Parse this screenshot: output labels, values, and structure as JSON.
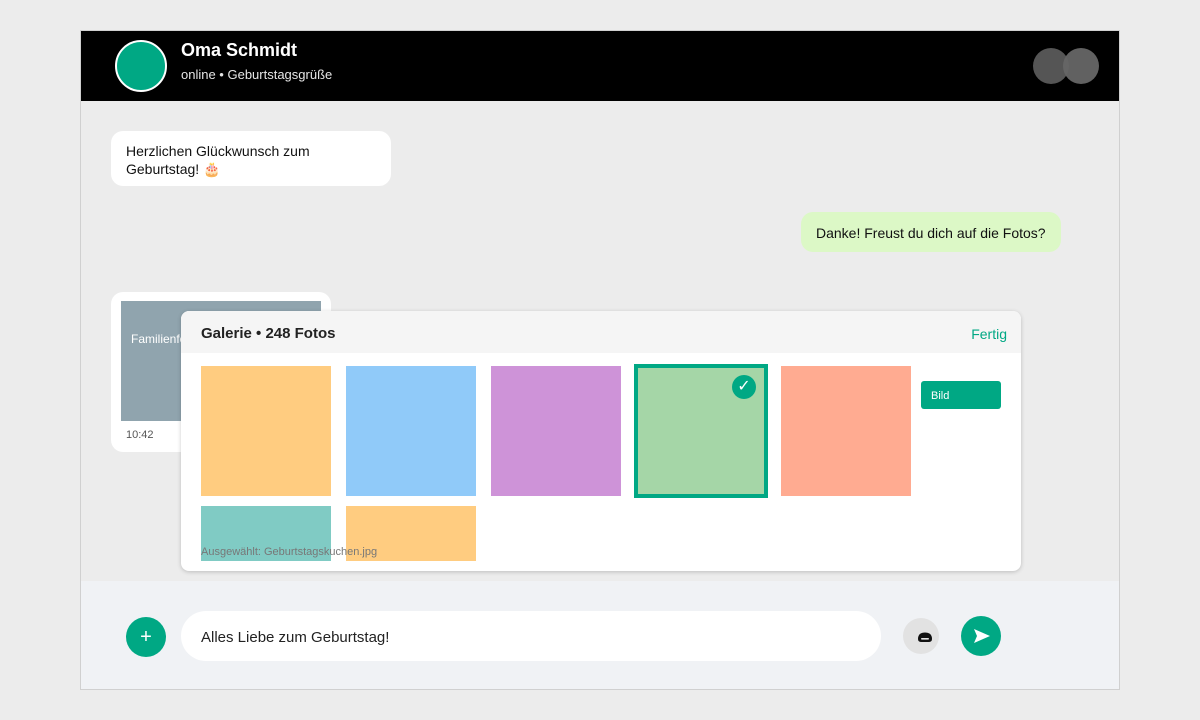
{
  "header": {
    "contact_name": "Oma Schmidt",
    "status": "online • Geburtstagsgrüße"
  },
  "messages": {
    "incoming_text": "Herzlichen Glückwunsch zum Geburtstag! 🎂",
    "outgoing_text": "Danke! Freust du dich auf die Fotos?",
    "photo_caption": "Familienfoto",
    "photo_time": "10:42"
  },
  "gallery": {
    "title": "Galerie • 248 Fotos",
    "done_label": "Fertig",
    "insert_label": "Bild",
    "selected_text": "Ausgewählt: Geburtstagskuchen.jpg",
    "check_symbol": "✓",
    "tile_colors": [
      "#ffcc80",
      "#90caf9",
      "#ce93d8",
      "#a5d6a7",
      "#ffab91",
      "#80cbc4",
      "#ffcc80"
    ],
    "selected_index": 3
  },
  "composer": {
    "message_value": "Alles Liebe zum Geburtstag!",
    "plus_symbol": "+"
  },
  "colors": {
    "accent": "#00a884",
    "header_bg": "#000000",
    "outgoing_bubble": "#dcf8c6"
  }
}
